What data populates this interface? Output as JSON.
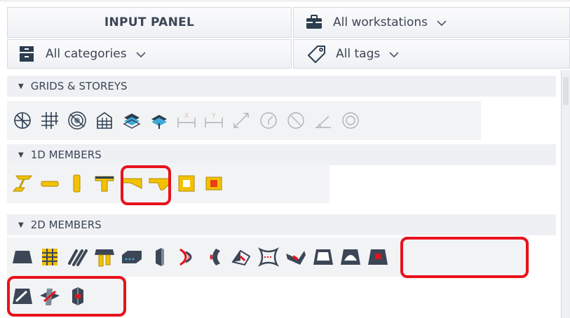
{
  "header": {
    "title": "INPUT PANEL",
    "workstations": "All workstations",
    "categories": "All categories",
    "tags": "All tags"
  },
  "sections": {
    "grids": "GRIDS & STOREYS",
    "members1d": "1D MEMBERS",
    "members2d": "2D MEMBERS"
  },
  "icons": {
    "grids": [
      "line-grid-icon",
      "rectangular-grid-icon",
      "radial-grid-icon",
      "storey-icon",
      "storey-surface-icon",
      "project-storey-icon",
      "dimension-x-icon",
      "dimension-y-icon",
      "dimension-diagonal-icon",
      "angle-icon",
      "circle-icon",
      "slope-icon",
      "circle-dim-icon"
    ],
    "members1d": [
      "beam-icon",
      "horizontal-beam-icon",
      "column-icon",
      "rib-icon",
      "haunch-icon",
      "tapered-haunch-icon",
      "box-section-icon",
      "cross-section-icon"
    ],
    "members2d": [
      "plate-icon",
      "wall-grid-icon",
      "shell-icon",
      "ribbed-plate-icon",
      "hollow-core-icon",
      "wall-icon",
      "curved-wall-icon",
      "shell-surface-icon",
      "free-form-icon",
      "membrane-icon",
      "load-panel-icon",
      "opening-icon",
      "arch-opening-icon",
      "plate-subregion-icon",
      "plate-edge-icon",
      "plate-intersection-icon",
      "solid-cut-icon"
    ]
  },
  "colors": {
    "accent_yellow": "#f2c200",
    "highlight_red": "#e8121b",
    "navy": "#2c3e50",
    "text": "#3c4656"
  }
}
